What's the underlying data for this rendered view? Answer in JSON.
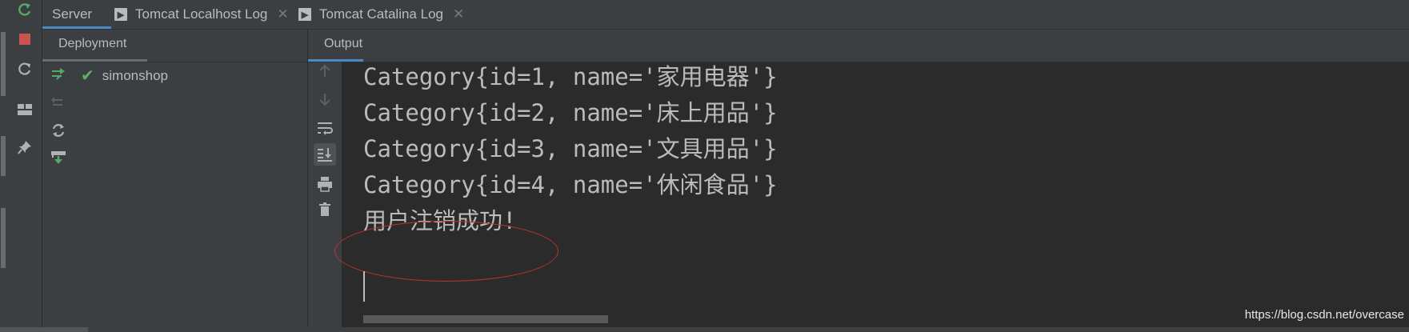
{
  "tabs": [
    {
      "label": "Server"
    },
    {
      "label": "Tomcat Localhost Log",
      "close": "✕"
    },
    {
      "label": "Tomcat Catalina Log",
      "close": "✕"
    }
  ],
  "deployment": {
    "title": "Deployment",
    "artifact": "simonshop"
  },
  "output": {
    "title": "Output",
    "lines": [
      "Category{id=1, name='家用电器'}",
      "Category{id=2, name='床上用品'}",
      "Category{id=3, name='文具用品'}",
      "Category{id=4, name='休闲食品'}",
      "用户注销成功!"
    ]
  },
  "watermark": "https://blog.csdn.net/overcase",
  "icons": {
    "rerun": "rerun-icon",
    "stop": "stop-icon",
    "refresh": "refresh-icon",
    "layout": "layout-icon",
    "pin": "pin-icon",
    "deploy": "deploy-all-icon",
    "undeploy": "undeploy-icon",
    "update": "update-icon",
    "deploy-artifact": "deploy-artifact-icon",
    "up": "arrow-up-icon",
    "down": "arrow-down-icon",
    "wrap": "soft-wrap-icon",
    "scroll-end": "scroll-to-end-icon",
    "print": "print-icon",
    "clear": "trash-icon"
  },
  "colors": {
    "accent": "#4a88c7",
    "stop": "#c75450",
    "success": "#5fb15f",
    "annotation": "#c03030"
  }
}
